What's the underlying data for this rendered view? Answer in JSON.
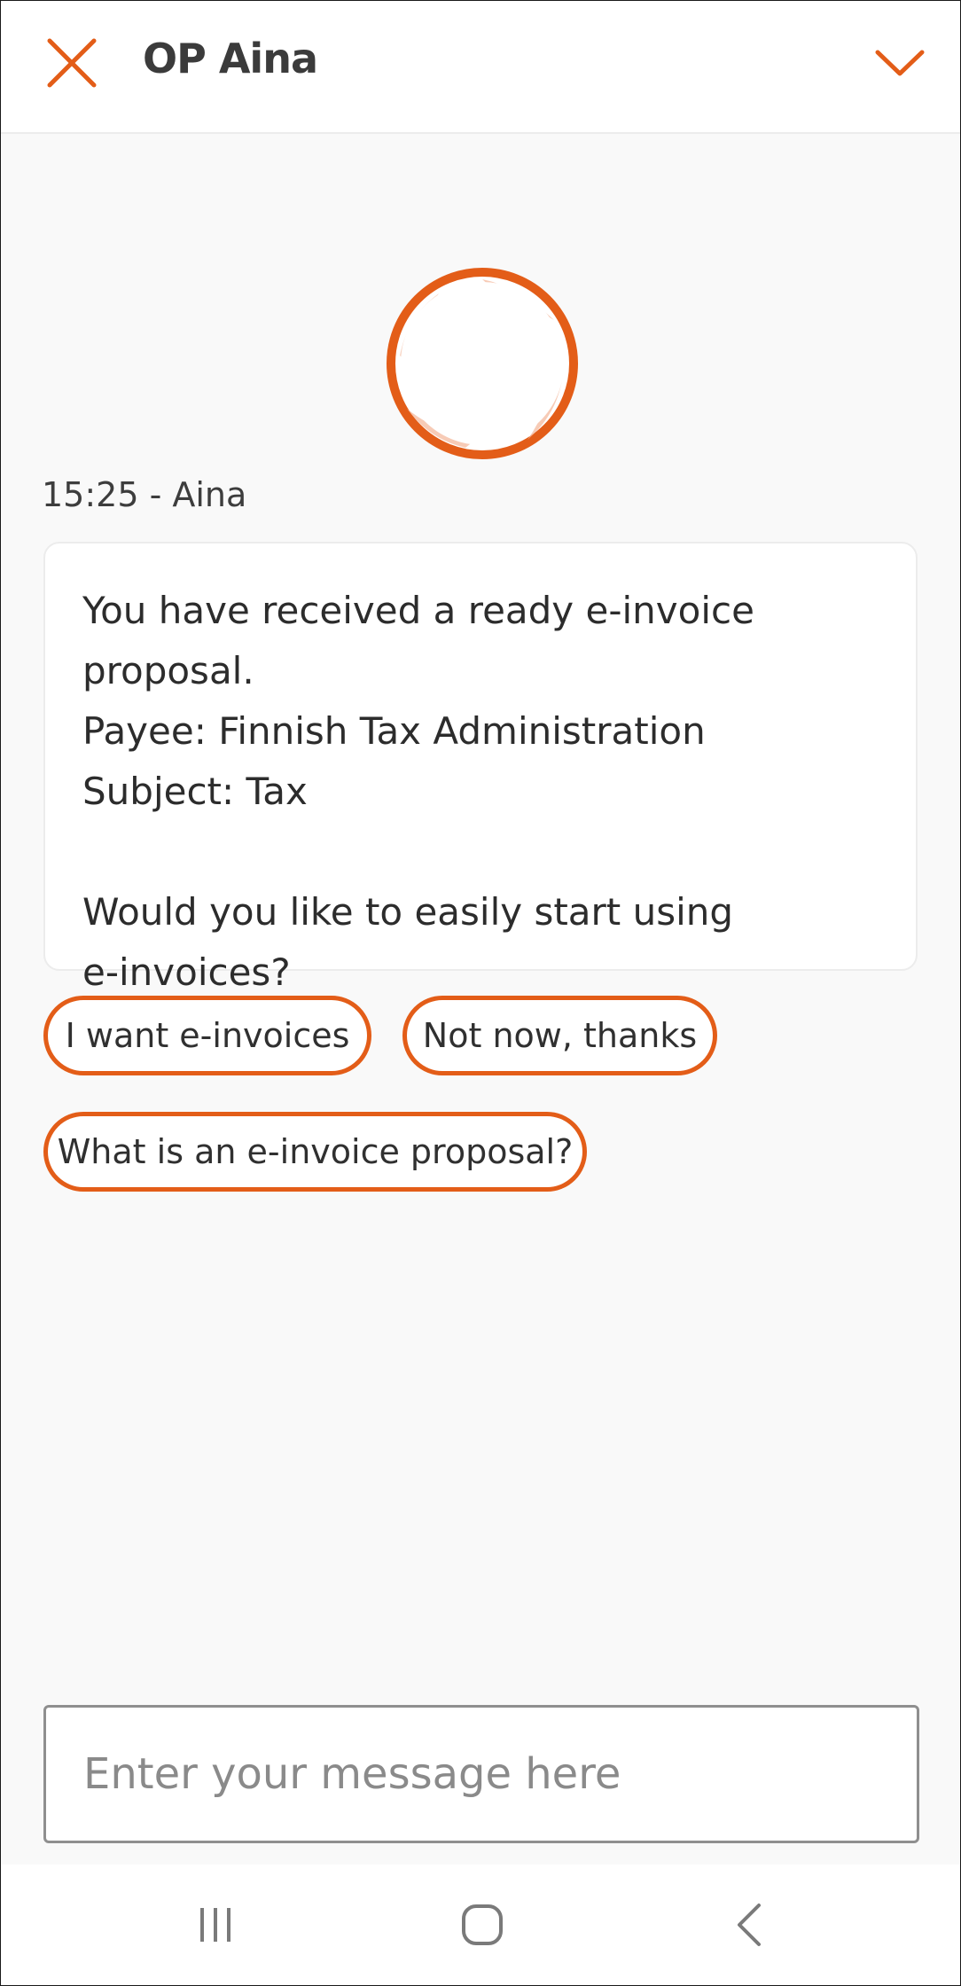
{
  "header": {
    "title": "OP Aina",
    "close_icon": "close-icon",
    "collapse_icon": "chevron-down-icon"
  },
  "colors": {
    "accent": "#e35d18",
    "background": "#f9f9f9",
    "text": "#333333"
  },
  "message": {
    "meta": "15:25 - Aina",
    "lines": [
      "You have received a ready e-invoice proposal.",
      "Payee: Finnish Tax Administration",
      "Subject: Tax",
      "Would you like to easily start using",
      "e-invoices?"
    ]
  },
  "quick_replies": [
    {
      "label": "I want e-invoices"
    },
    {
      "label": "Not now, thanks"
    },
    {
      "label": "What is an e-invoice proposal?"
    }
  ],
  "composer": {
    "placeholder": "Enter your message here",
    "value": ""
  },
  "navbar": {
    "recent_icon": "recent-apps-icon",
    "home_icon": "home-icon",
    "back_icon": "back-icon"
  }
}
